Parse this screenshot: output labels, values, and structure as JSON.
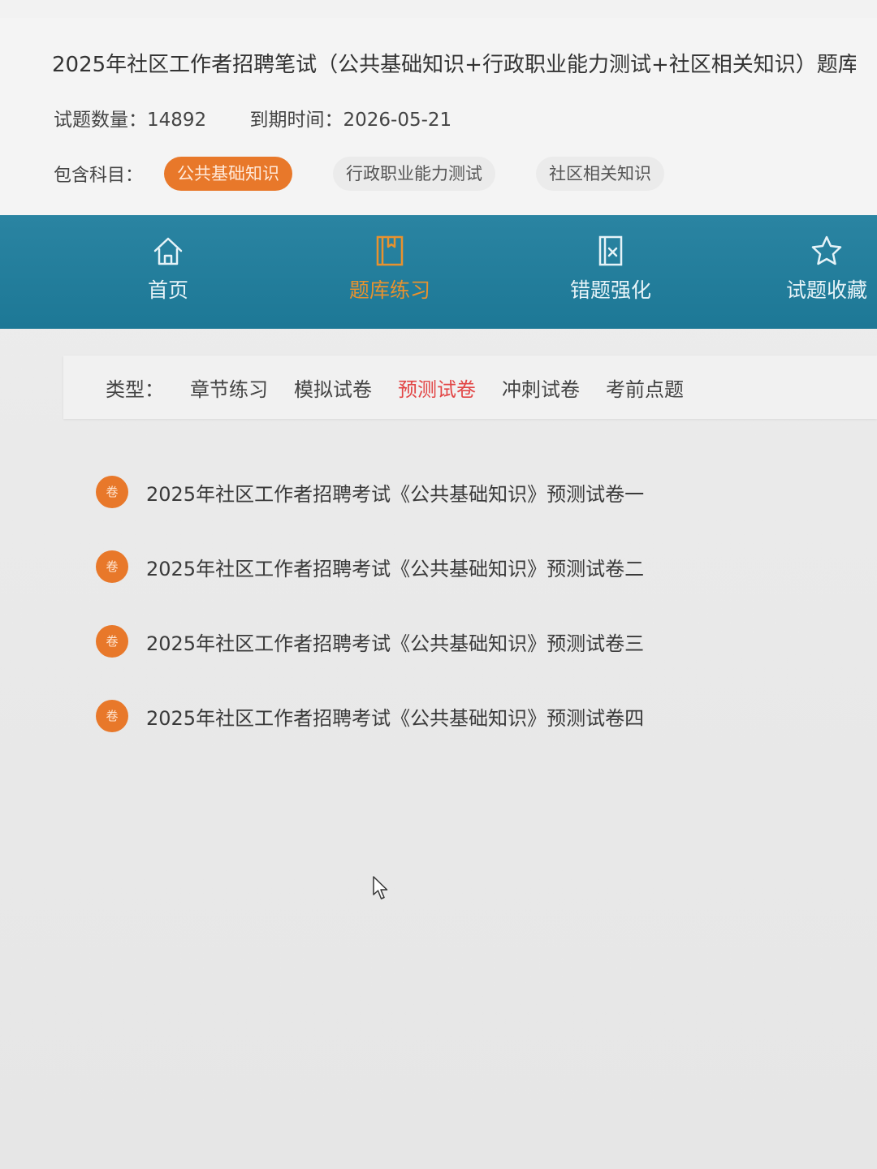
{
  "header": {
    "title": "2025年社区工作者招聘笔试（公共基础知识+行政职业能力测试+社区相关知识）题库",
    "question_count_label": "试题数量：",
    "question_count": "14892",
    "expiry_label": "到期时间：",
    "expiry_date": "2026-05-21",
    "subjects_label": "包含科目：",
    "subjects": [
      {
        "label": "公共基础知识",
        "active": true
      },
      {
        "label": "行政职业能力测试",
        "active": false
      },
      {
        "label": "社区相关知识",
        "active": false
      }
    ]
  },
  "nav": {
    "items": [
      {
        "label": "首页",
        "icon": "home-icon"
      },
      {
        "label": "题库练习",
        "icon": "book-icon",
        "active": true
      },
      {
        "label": "错题强化",
        "icon": "wrong-answer-icon"
      },
      {
        "label": "试题收藏",
        "icon": "star-icon"
      }
    ]
  },
  "types": {
    "label": "类型：",
    "tabs": [
      {
        "label": "章节练习"
      },
      {
        "label": "模拟试卷"
      },
      {
        "label": "预测试卷",
        "active": true
      },
      {
        "label": "冲刺试卷"
      },
      {
        "label": "考前点题"
      }
    ]
  },
  "papers": {
    "badge": "卷",
    "items": [
      {
        "title": "2025年社区工作者招聘考试《公共基础知识》预测试卷一"
      },
      {
        "title": "2025年社区工作者招聘考试《公共基础知识》预测试卷二"
      },
      {
        "title": "2025年社区工作者招聘考试《公共基础知识》预测试卷三"
      },
      {
        "title": "2025年社区工作者招聘考试《公共基础知识》预测试卷四"
      }
    ]
  },
  "colors": {
    "accent_orange": "#e8782a",
    "nav_blue": "#1d7896",
    "active_red": "#e24545"
  }
}
